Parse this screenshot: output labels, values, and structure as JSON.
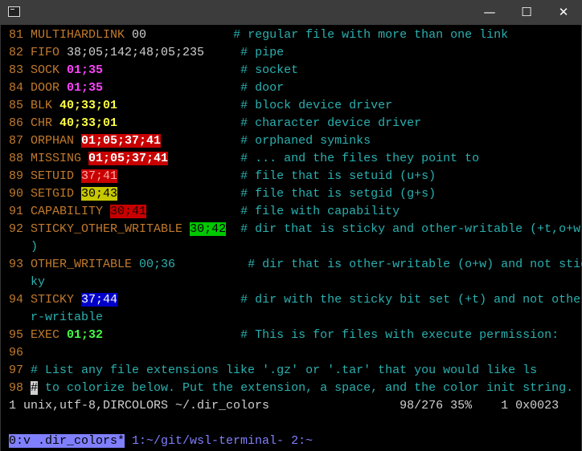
{
  "window": {
    "minimize": "—",
    "maximize": "☐",
    "close": "✕"
  },
  "lines": [
    [
      [
        "n",
        "81 "
      ],
      [
        "k",
        "MULTIHARDLINK "
      ],
      [
        "p",
        "00"
      ],
      [
        "p",
        "            "
      ],
      [
        "cm",
        "# regular file with more than one link"
      ]
    ],
    [
      [
        "n",
        "82 "
      ],
      [
        "k",
        "FIFO "
      ],
      [
        "p",
        "38;05;142;48;05;235"
      ],
      [
        "p",
        "     "
      ],
      [
        "cm",
        "# pipe"
      ]
    ],
    [
      [
        "n",
        "83 "
      ],
      [
        "k",
        "SOCK "
      ],
      [
        "mg",
        "01;35"
      ],
      [
        "p",
        "                   "
      ],
      [
        "cm",
        "# socket"
      ]
    ],
    [
      [
        "n",
        "84 "
      ],
      [
        "k",
        "DOOR "
      ],
      [
        "mg",
        "01;35"
      ],
      [
        "p",
        "                   "
      ],
      [
        "cm",
        "# door"
      ]
    ],
    [
      [
        "n",
        "85 "
      ],
      [
        "k",
        "BLK "
      ],
      [
        "yb",
        "40;33;01"
      ],
      [
        "p",
        "                 "
      ],
      [
        "cm",
        "# block device driver"
      ]
    ],
    [
      [
        "n",
        "86 "
      ],
      [
        "k",
        "CHR "
      ],
      [
        "yb",
        "40;33;01"
      ],
      [
        "p",
        "                 "
      ],
      [
        "cm",
        "# character device driver"
      ]
    ],
    [
      [
        "n",
        "87 "
      ],
      [
        "k",
        "ORPHAN "
      ],
      [
        "rb",
        "01;05;37;41"
      ],
      [
        "p",
        "           "
      ],
      [
        "cm",
        "# orphaned syminks"
      ]
    ],
    [
      [
        "n",
        "88 "
      ],
      [
        "k",
        "MISSING "
      ],
      [
        "rb",
        "01;05;37;41"
      ],
      [
        "p",
        "          "
      ],
      [
        "cm",
        "# ... and the files they point to"
      ]
    ],
    [
      [
        "n",
        "89 "
      ],
      [
        "k",
        "SETUID "
      ],
      [
        "r41",
        "37;41"
      ],
      [
        "p",
        "                 "
      ],
      [
        "cm",
        "# file that is setuid (u+s)"
      ]
    ],
    [
      [
        "n",
        "90 "
      ],
      [
        "k",
        "SETGID "
      ],
      [
        "y43",
        "30;43"
      ],
      [
        "p",
        "                 "
      ],
      [
        "cm",
        "# file that is setgid (g+s)"
      ]
    ],
    [
      [
        "n",
        "91 "
      ],
      [
        "k",
        "CAPABILITY "
      ],
      [
        "r30",
        "30;41"
      ],
      [
        "p",
        "             "
      ],
      [
        "cm",
        "# file with capability"
      ]
    ],
    [
      [
        "n",
        "92 "
      ],
      [
        "k",
        "STICKY_OTHER_WRITABLE "
      ],
      [
        "g42",
        "30;42"
      ],
      [
        "p",
        "  "
      ],
      [
        "cm",
        "# dir that is sticky and other-writable (+t,o+w"
      ]
    ],
    [
      [
        "p",
        "   "
      ],
      [
        "cm",
        ")"
      ]
    ],
    [
      [
        "n",
        "93 "
      ],
      [
        "k",
        "OTHER_WRITABLE "
      ],
      [
        "cm",
        "00;36"
      ],
      [
        "p",
        "          "
      ],
      [
        "cm",
        "# dir that is other-writable (o+w) and not stic"
      ]
    ],
    [
      [
        "p",
        "   "
      ],
      [
        "cm",
        "ky"
      ]
    ],
    [
      [
        "n",
        "94 "
      ],
      [
        "k",
        "STICKY "
      ],
      [
        "b44",
        "37;44"
      ],
      [
        "p",
        "                 "
      ],
      [
        "cm",
        "# dir with the sticky bit set (+t) and not othe"
      ]
    ],
    [
      [
        "p",
        "   "
      ],
      [
        "cm",
        "r-writable"
      ]
    ],
    [
      [
        "n",
        "95 "
      ],
      [
        "k",
        "EXEC "
      ],
      [
        "cg",
        "01;32"
      ],
      [
        "p",
        "                   "
      ],
      [
        "cm",
        "# This is for files with execute permission:"
      ]
    ],
    [
      [
        "n",
        "96"
      ]
    ],
    [
      [
        "n",
        "97 "
      ],
      [
        "cm",
        "# List any file extensions like '.gz' or '.tar' that you would like ls"
      ]
    ],
    [
      [
        "n",
        "98 "
      ],
      [
        "cur",
        "#"
      ],
      [
        "cm",
        " to colorize below. Put the extension, a space, and the color init string."
      ]
    ],
    [
      [
        "st",
        "1 unix,utf-8,DIRCOLORS ~/.dir_colors                  98/276 35%    1 0x0023"
      ]
    ],
    [],
    [
      [
        "tsel",
        "0:v .dir_colors*"
      ],
      [
        "tx",
        " 1:~/git/wsl-terminal- 2:~"
      ]
    ]
  ]
}
